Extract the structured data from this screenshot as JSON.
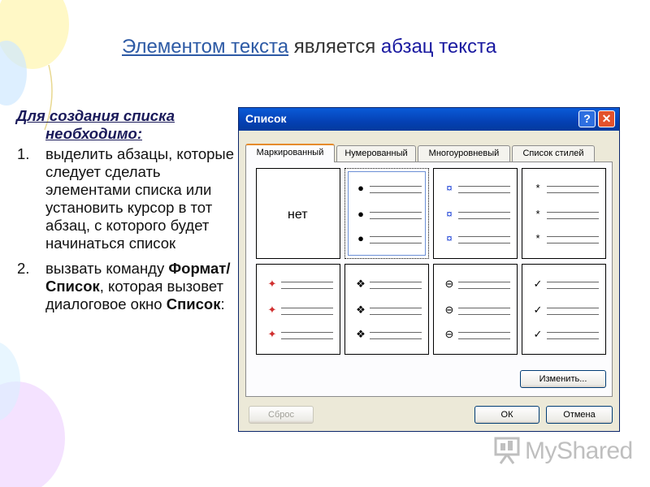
{
  "slide": {
    "title_link": "Элементом текста",
    "title_mid": " является ",
    "title_emph": "абзац текста",
    "heading_line1": "Для создания списка",
    "heading_line2": "необходимо:",
    "step1_num": "1.",
    "step1_text": "выделить абзацы, которые следует сделать элементами списка или установить курсор в тот абзац, с которого будет начинаться список",
    "step2_num": "2.",
    "step2_pre": "вызвать команду ",
    "step2_cmd": "Формат/Список",
    "step2_mid": ", которая вызовет диалоговое окно ",
    "step2_dialog": "Список",
    "step2_end": ":"
  },
  "dialog": {
    "title": "Список",
    "help_glyph": "?",
    "close_glyph": "✕",
    "tabs": [
      {
        "label": "Маркированный",
        "active": true
      },
      {
        "label": "Нумерованный",
        "active": false
      },
      {
        "label": "Многоуровневый",
        "active": false
      },
      {
        "label": "Список стилей",
        "active": false
      }
    ],
    "none_label": "нет",
    "bullet_styles": [
      {
        "name": "none"
      },
      {
        "name": "dot-bullet",
        "glyph": "●",
        "color": "#000000",
        "selected": true
      },
      {
        "name": "star-bullet",
        "glyph": "¤",
        "color": "#1a3fd6"
      },
      {
        "name": "asterisk-bullet",
        "glyph": "*",
        "color": "#000000"
      },
      {
        "name": "color-arrow-bullet",
        "glyph": "✦",
        "color": "#d03030"
      },
      {
        "name": "diamond-bullet",
        "glyph": "❖",
        "color": "#000000"
      },
      {
        "name": "clock-bullet",
        "glyph": "⊖",
        "color": "#000000"
      },
      {
        "name": "check-bullet",
        "glyph": "✓",
        "color": "#000000"
      }
    ],
    "change_button": "Изменить...",
    "reset_button": "Сброс",
    "ok_button": "ОК",
    "cancel_button": "Отмена"
  },
  "watermark": {
    "text": "MyShared"
  }
}
